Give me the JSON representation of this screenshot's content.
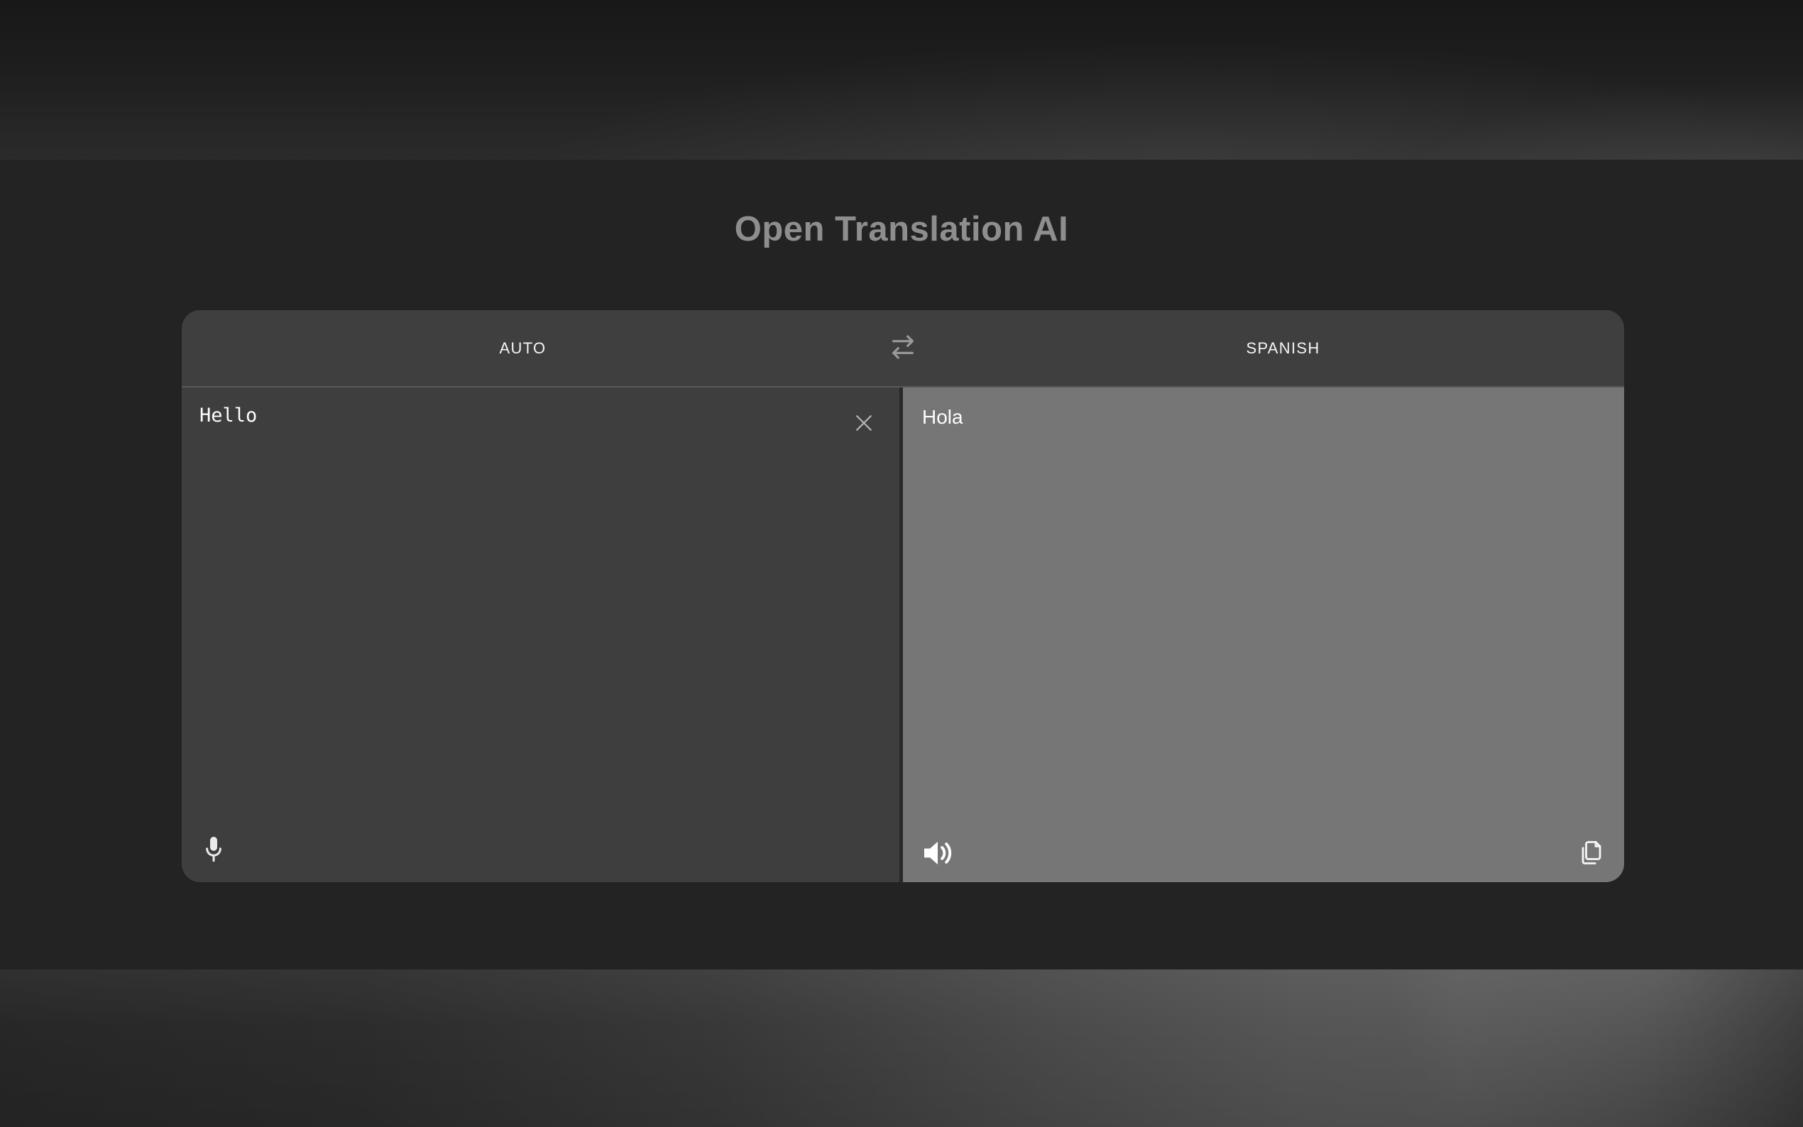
{
  "app": {
    "title": "Open Translation AI"
  },
  "translator": {
    "swap_button": {
      "icon": "swap-arrows-icon"
    },
    "source": {
      "language_label": "AUTO",
      "text": "Hello",
      "clear_icon": "x-clear-icon",
      "mic_icon": "microphone-icon"
    },
    "target": {
      "language_label": "SPANISH",
      "text": "Hola",
      "speaker_icon": "speaker-icon",
      "copy_icon": "copy-icon"
    }
  },
  "colors": {
    "page_background": "#232323",
    "card_header": "#3f3f3f",
    "source_panel": "#3e3e3e",
    "target_panel": "#767676",
    "panel_divider": "#282828",
    "title_text": "#8e8e8e",
    "label_text": "#f5f5f5",
    "icon_gray": "#9a9a9a"
  }
}
